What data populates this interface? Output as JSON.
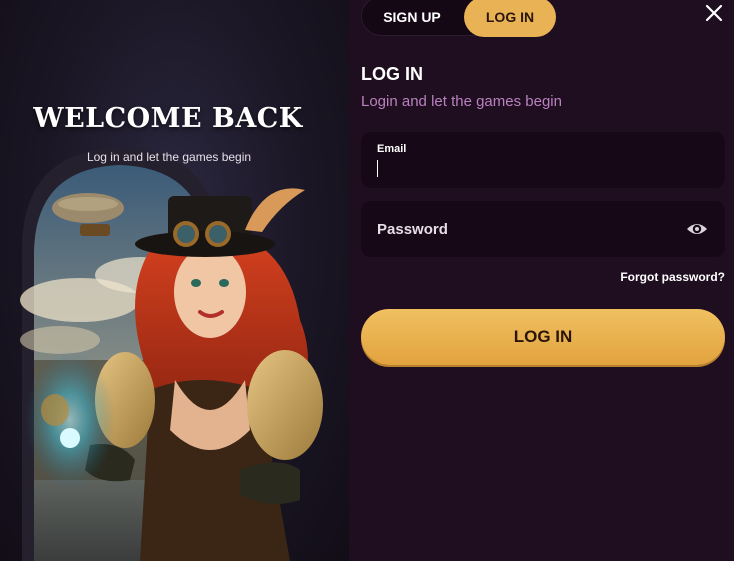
{
  "welcome": {
    "title": "WELCOME BACK",
    "subtitle": "Log in and let the games begin"
  },
  "tabs": {
    "signup_label": "SIGN UP",
    "login_label": "LOG IN",
    "active": "login"
  },
  "form": {
    "title": "LOG IN",
    "subtitle": "Login and let the games begin",
    "email": {
      "label": "Email",
      "value": ""
    },
    "password": {
      "placeholder": "Password",
      "value": ""
    },
    "forgot_label": "Forgot password?",
    "submit_label": "LOG IN"
  },
  "icons": {
    "close": "close-icon",
    "eye": "eye-icon"
  },
  "colors": {
    "accent": "#e9b255",
    "panel_bg": "#1f0d20",
    "field_bg": "#160817",
    "subtitle": "#b982bf"
  }
}
